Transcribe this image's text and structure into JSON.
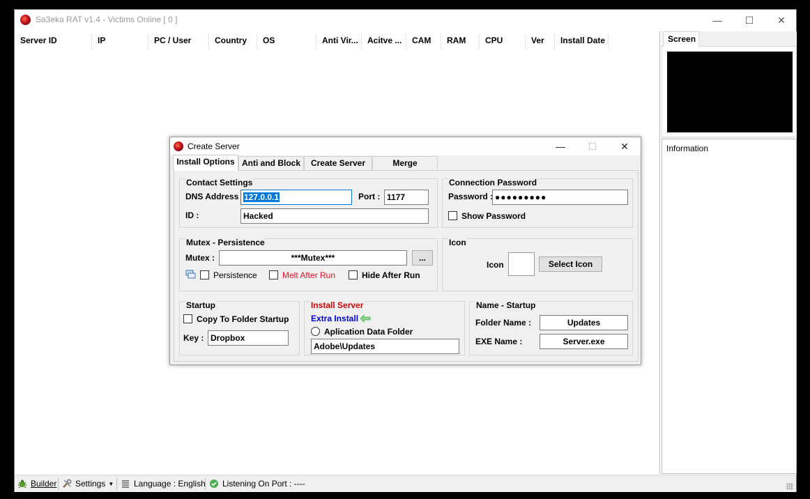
{
  "window": {
    "title": "Sa3eka RAT v1.4 - Victims Online [ 0 ]",
    "minimize": "—",
    "maximize": "☐",
    "close": "✕"
  },
  "columns": [
    "Server ID",
    "IP",
    "PC / User",
    "Country",
    "OS",
    "Anti Vir...",
    "Acitve ...",
    "CAM",
    "RAM",
    "CPU",
    "Ver",
    "Install Date"
  ],
  "side": {
    "screen_tab": "Screen",
    "information": "Information"
  },
  "statusbar": {
    "builder": "Builder",
    "settings": "Settings",
    "language": "Language : English",
    "listening": "Listening On Port : ----"
  },
  "dialog": {
    "title": "Create Server",
    "tabs": [
      "Install Options",
      "Anti and Block",
      "Create Server",
      "Merge"
    ],
    "contact": {
      "title": "Contact Settings",
      "dns_label": "DNS Address :",
      "dns_value": "127.0.0.1",
      "port_label": "Port :",
      "port_value": "1177",
      "id_label": "ID :",
      "id_value": "Hacked"
    },
    "password": {
      "title": "Connection Password",
      "label": "Password :",
      "value": "●●●●●●●●●",
      "show": "Show Password"
    },
    "mutex": {
      "title": "Mutex - Persistence",
      "label": "Mutex :",
      "value": "***Mutex***",
      "browse": "...",
      "persistence": "Persistence",
      "melt": "Melt After Run",
      "hide": "Hide After Run"
    },
    "icon": {
      "title": "Icon",
      "label": "Icon",
      "select": "Select Icon"
    },
    "startup": {
      "title": "Startup",
      "copy": "Copy To Folder Startup",
      "key_label": "Key :",
      "key_value": "Dropbox"
    },
    "install": {
      "title": "Install Server",
      "extra": "Extra Install",
      "appdata": "Aplication Data Folder",
      "path": "Adobe\\Updates"
    },
    "name_startup": {
      "title": "Name - Startup",
      "folder_label": "Folder Name   :",
      "folder_value": "Updates",
      "exe_label": "EXE Name     :",
      "exe_value": "Server.exe"
    }
  },
  "colors": {
    "accent": "#0078d7",
    "red": "#e81123",
    "install_red": "#d10000",
    "extra_blue": "#0000cc",
    "arrow_green": "#4caf50"
  }
}
